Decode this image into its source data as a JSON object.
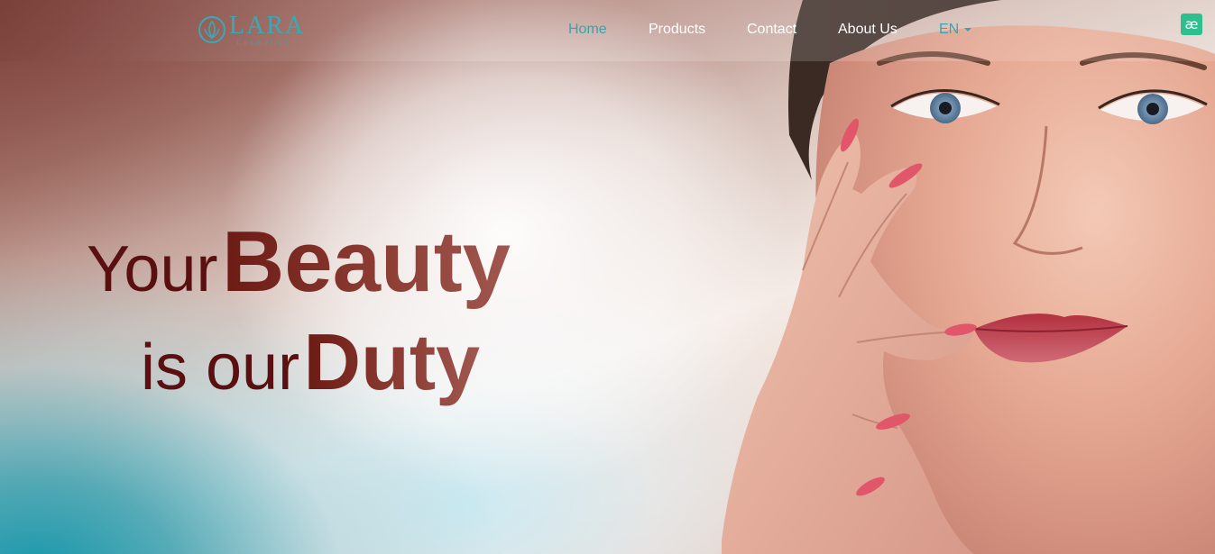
{
  "brand": {
    "logo_word": "LARA",
    "logo_sub": "Cosmetics",
    "accent_color": "#3aa9b5"
  },
  "nav": {
    "items": [
      {
        "label": "Home",
        "active": true
      },
      {
        "label": "Products",
        "active": false
      },
      {
        "label": "Contact",
        "active": false
      },
      {
        "label": "About Us",
        "active": false
      }
    ],
    "language": "EN"
  },
  "extension_badge": {
    "glyph": "æ",
    "icon": "extension-icon",
    "color": "#2fbf8f"
  },
  "hero": {
    "line1_small": "Your",
    "line1_big": "Beauty",
    "line2_small": "is our",
    "line2_big": "Duty",
    "text_color": "#5a1010"
  }
}
